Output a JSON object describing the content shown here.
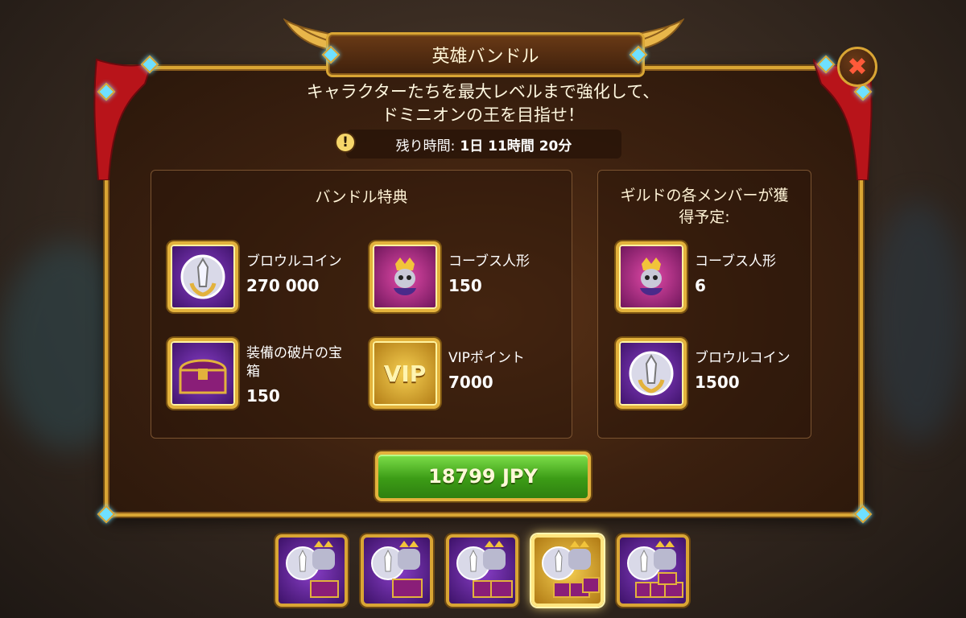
{
  "dialog": {
    "title": "英雄バンドル",
    "subtitle_line1": "キャラクターたちを最大レベルまで強化して、",
    "subtitle_line2": "ドミニオンの王を目指せ！",
    "timer": {
      "label": "残り時間:",
      "value": "1日 11時間 20分"
    },
    "close_icon": "close-icon"
  },
  "bundle_panel": {
    "title": "バンドル特典",
    "items": [
      {
        "name": "ブロウルコイン",
        "value": "270 000",
        "icon": "brawl-coin-icon"
      },
      {
        "name": "コーブス人形",
        "value": "150",
        "icon": "corvus-doll-icon"
      },
      {
        "name_line1": "装備の破片の宝",
        "name_line2": "箱",
        "value": "150",
        "icon": "equipment-chest-icon"
      },
      {
        "name": "VIPポイント",
        "value": "7000",
        "icon": "vip-icon",
        "icon_text": "VIP"
      }
    ]
  },
  "guild_panel": {
    "title_line1": "ギルドの各メンバーが獲",
    "title_line2": "得予定:",
    "items": [
      {
        "name": "コーブス人形",
        "value": "6",
        "icon": "corvus-doll-icon"
      },
      {
        "name": "ブロウルコイン",
        "value": "1500",
        "icon": "brawl-coin-icon"
      }
    ]
  },
  "purchase": {
    "price_label": "18799 JPY"
  },
  "bundle_tabs": [
    {
      "icon": "bundle-tier-1-icon",
      "selected": false
    },
    {
      "icon": "bundle-tier-2-icon",
      "selected": false
    },
    {
      "icon": "bundle-tier-3-icon",
      "selected": false
    },
    {
      "icon": "bundle-tier-4-icon",
      "selected": true
    },
    {
      "icon": "bundle-tier-5-icon",
      "selected": false
    }
  ],
  "colors": {
    "gold_frame": "#d9a534",
    "button_green": "#3c9c16",
    "accent_cyan": "#6fe0ff",
    "close_red": "#ff5a3a"
  }
}
